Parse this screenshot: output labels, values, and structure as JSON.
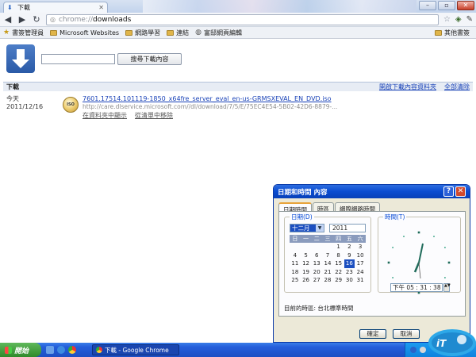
{
  "browser": {
    "tab_title": "下載",
    "url_scheme": "chrome://",
    "url_path": "downloads"
  },
  "bookmarks": {
    "items": [
      "書簽管理員",
      "Microsoft Websites",
      "網路學習",
      "連結",
      "富邸網頁編輯"
    ],
    "other": "其他書簽"
  },
  "downloads_page": {
    "search_button": "搜尋下載內容",
    "section_label": "下載",
    "open_folder_link": "開啟下載內容資料夾",
    "clear_all_link": "全部清除",
    "item": {
      "date_label": "今天",
      "date": "2011/12/16",
      "icon_label": "ISO",
      "filename": "7601.17514.101119-1850_x64fre_server_eval_en-us-GRMSXEVAL_EN_DVD.iso",
      "url": "http://care.dlservice.microsoft.com//dl/download/7/5/E/75EC4E54-5B02-42D6-8879-...",
      "show_in_folder": "在資料夾中顯示",
      "remove_from_list": "從清單中移除"
    }
  },
  "dialog": {
    "title": "日期和時間 內容",
    "help_btn": "?",
    "close_btn": "✕",
    "tabs": [
      "日期時間",
      "時區",
      "網際網路時間"
    ],
    "date_group_label": "日期(D)",
    "time_group_label": "時間(T)",
    "month": "十二月",
    "year": "2011",
    "weekdays": [
      "日",
      "一",
      "二",
      "三",
      "四",
      "五",
      "六"
    ],
    "calendar_rows": [
      [
        "",
        "",
        "",
        "",
        "1",
        "2",
        "3"
      ],
      [
        "4",
        "5",
        "6",
        "7",
        "8",
        "9",
        "10"
      ],
      [
        "11",
        "12",
        "13",
        "14",
        "15",
        "16",
        "17"
      ],
      [
        "18",
        "19",
        "20",
        "21",
        "22",
        "23",
        "24"
      ],
      [
        "25",
        "26",
        "27",
        "28",
        "29",
        "30",
        "31"
      ]
    ],
    "selected_day": "16",
    "time_display": "下午   05 : 31 : 38",
    "time_spin": "▲▼",
    "timezone_text": "目前的時區: 台北標準時間",
    "ok_button": "確定",
    "cancel_button": "取消"
  },
  "taskbar": {
    "start_label": "開始",
    "task_label": "下載 - Google Chrome"
  },
  "colors": {
    "link": "#1a43b8",
    "xp_title": "#0a4bd0",
    "selection": "#1c4fc0"
  }
}
